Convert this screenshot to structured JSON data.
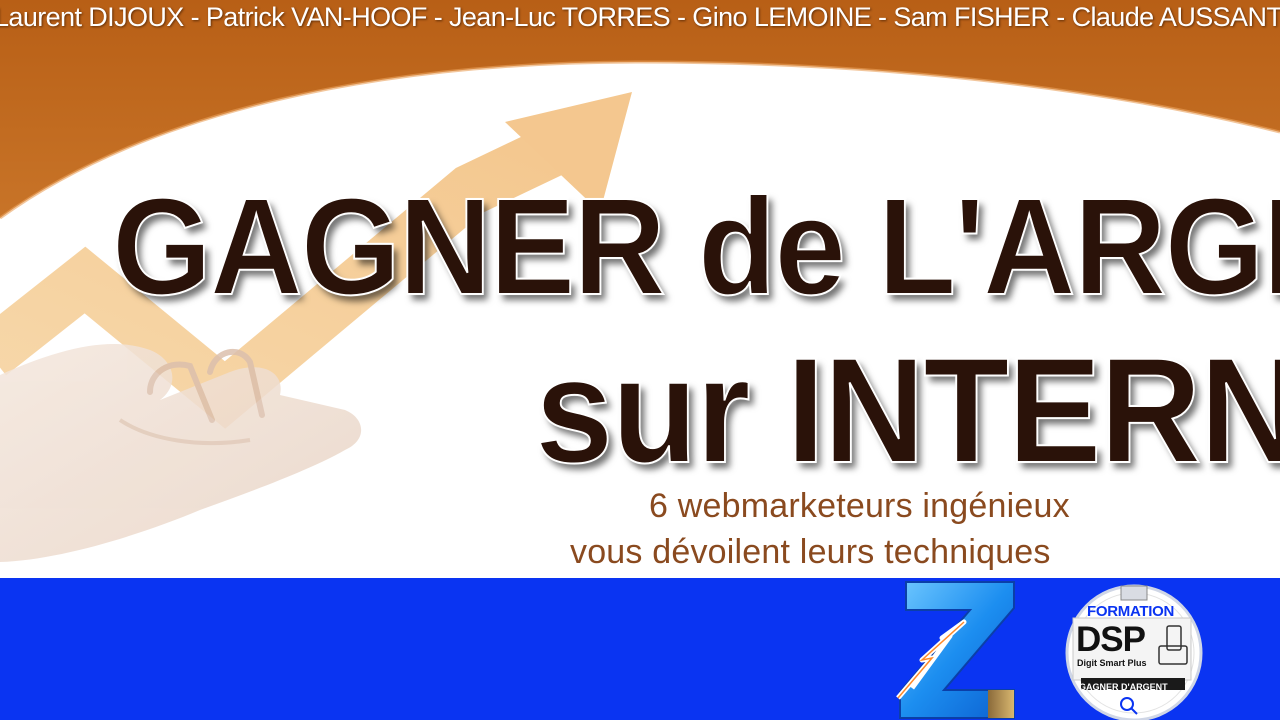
{
  "banner": {
    "authors": "Laurent DIJOUX - Patrick VAN-HOOF - Jean-Luc TORRES - Gino LEMOINE - Sam FISHER - Claude AUSSANT",
    "title_line1": "GAGNER de L'ARGENT",
    "title_line2": "sur INTERNET",
    "subtitle_line1": "6 webmarketeurs ingénieux",
    "subtitle_line2": "vous dévoilent leurs techniques"
  },
  "logos": {
    "z_logo": "Z",
    "dsp": {
      "formation": "FORMATION",
      "main": "DSP",
      "tagline": "Digit Smart Plus",
      "bottom": "GAGNER D'ARGENT"
    }
  },
  "colors": {
    "orange_band": "#c0661c",
    "title_text": "#2a1209",
    "subtitle_text": "#8a4a1f",
    "footer_blue": "#0a34f2",
    "arrow": "#f4c98e"
  },
  "icons": [
    "growth-arrow-icon",
    "hand-illustration",
    "z-lightning-logo",
    "dsp-formation-logo"
  ]
}
